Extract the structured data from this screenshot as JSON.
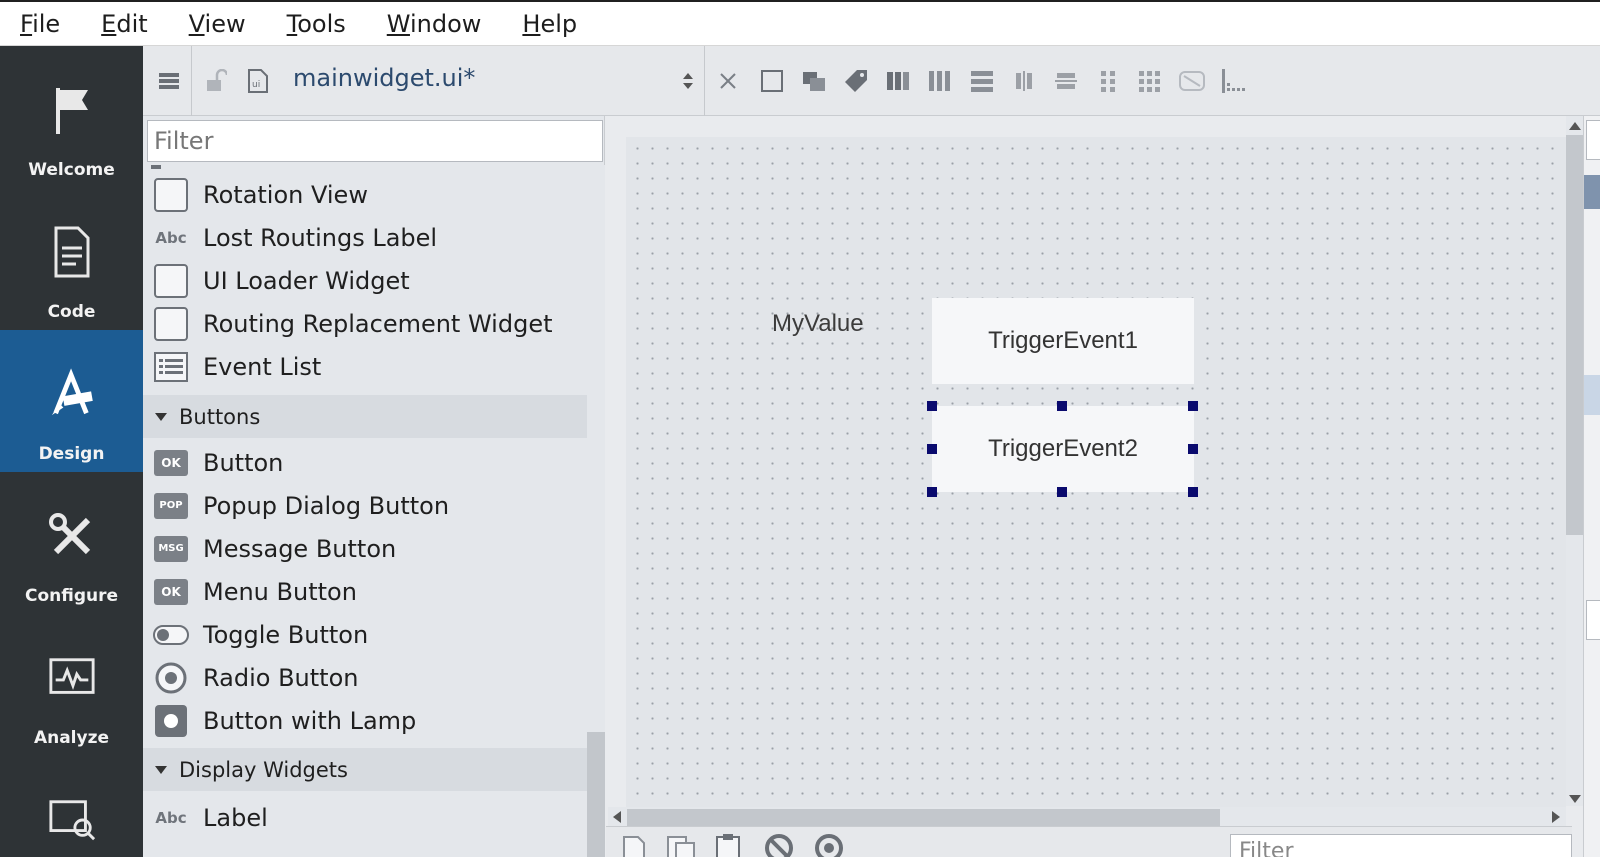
{
  "menu": [
    {
      "mnemonic": "F",
      "rest": "ile"
    },
    {
      "mnemonic": "E",
      "rest": "dit"
    },
    {
      "mnemonic": "V",
      "rest": "iew"
    },
    {
      "mnemonic": "T",
      "rest": "ools"
    },
    {
      "mnemonic": "W",
      "rest": "indow"
    },
    {
      "mnemonic": "H",
      "rest": "elp"
    }
  ],
  "modes": [
    {
      "label": "Welcome",
      "icon": "flag-icon",
      "active": false
    },
    {
      "label": "Code",
      "icon": "document-icon",
      "active": false
    },
    {
      "label": "Design",
      "icon": "design-pen-ruler-icon",
      "active": true
    },
    {
      "label": "Configure",
      "icon": "wrench-screwdriver-icon",
      "active": false
    },
    {
      "label": "Analyze",
      "icon": "chart-monitor-icon",
      "active": false
    }
  ],
  "document": {
    "title": "mainwidget.ui*"
  },
  "widgetbox": {
    "filter_placeholder": "Filter",
    "items_top": [
      {
        "label": "Rotation View",
        "icon": "box"
      },
      {
        "label": "Lost Routings Label",
        "icon": "abc"
      },
      {
        "label": "UI Loader Widget",
        "icon": "box"
      },
      {
        "label": "Routing Replacement Widget",
        "icon": "box"
      },
      {
        "label": "Event List",
        "icon": "list"
      }
    ],
    "category_buttons": "Buttons",
    "items_buttons": [
      {
        "label": "Button",
        "icon": "ok",
        "tag": "OK"
      },
      {
        "label": "Popup Dialog Button",
        "icon": "pop",
        "tag": "POP"
      },
      {
        "label": "Message Button",
        "icon": "msg",
        "tag": "MSG"
      },
      {
        "label": "Menu Button",
        "icon": "ok",
        "tag": "OK"
      },
      {
        "label": "Toggle Button",
        "icon": "toggle"
      },
      {
        "label": "Radio Button",
        "icon": "radio"
      },
      {
        "label": "Button with Lamp",
        "icon": "lamp"
      }
    ],
    "category_display": "Display Widgets",
    "items_display": [
      {
        "label": "Label",
        "icon": "abc"
      }
    ],
    "abc_text": "Abc"
  },
  "form": {
    "label_text": "MyValue",
    "button1": "TriggerEvent1",
    "button2": "TriggerEvent2"
  },
  "bottom": {
    "filter_placeholder": "Filter"
  }
}
